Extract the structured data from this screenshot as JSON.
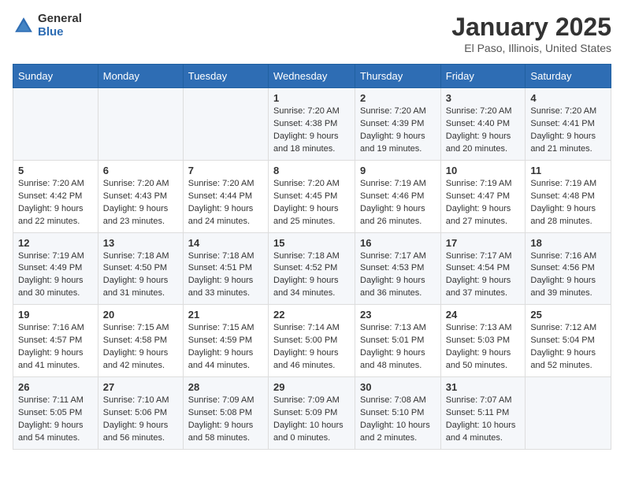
{
  "logo": {
    "general": "General",
    "blue": "Blue"
  },
  "title": "January 2025",
  "subtitle": "El Paso, Illinois, United States",
  "days_of_week": [
    "Sunday",
    "Monday",
    "Tuesday",
    "Wednesday",
    "Thursday",
    "Friday",
    "Saturday"
  ],
  "weeks": [
    [
      {
        "day": "",
        "content": ""
      },
      {
        "day": "",
        "content": ""
      },
      {
        "day": "",
        "content": ""
      },
      {
        "day": "1",
        "content": "Sunrise: 7:20 AM\nSunset: 4:38 PM\nDaylight: 9 hours and 18 minutes."
      },
      {
        "day": "2",
        "content": "Sunrise: 7:20 AM\nSunset: 4:39 PM\nDaylight: 9 hours and 19 minutes."
      },
      {
        "day": "3",
        "content": "Sunrise: 7:20 AM\nSunset: 4:40 PM\nDaylight: 9 hours and 20 minutes."
      },
      {
        "day": "4",
        "content": "Sunrise: 7:20 AM\nSunset: 4:41 PM\nDaylight: 9 hours and 21 minutes."
      }
    ],
    [
      {
        "day": "5",
        "content": "Sunrise: 7:20 AM\nSunset: 4:42 PM\nDaylight: 9 hours and 22 minutes."
      },
      {
        "day": "6",
        "content": "Sunrise: 7:20 AM\nSunset: 4:43 PM\nDaylight: 9 hours and 23 minutes."
      },
      {
        "day": "7",
        "content": "Sunrise: 7:20 AM\nSunset: 4:44 PM\nDaylight: 9 hours and 24 minutes."
      },
      {
        "day": "8",
        "content": "Sunrise: 7:20 AM\nSunset: 4:45 PM\nDaylight: 9 hours and 25 minutes."
      },
      {
        "day": "9",
        "content": "Sunrise: 7:19 AM\nSunset: 4:46 PM\nDaylight: 9 hours and 26 minutes."
      },
      {
        "day": "10",
        "content": "Sunrise: 7:19 AM\nSunset: 4:47 PM\nDaylight: 9 hours and 27 minutes."
      },
      {
        "day": "11",
        "content": "Sunrise: 7:19 AM\nSunset: 4:48 PM\nDaylight: 9 hours and 28 minutes."
      }
    ],
    [
      {
        "day": "12",
        "content": "Sunrise: 7:19 AM\nSunset: 4:49 PM\nDaylight: 9 hours and 30 minutes."
      },
      {
        "day": "13",
        "content": "Sunrise: 7:18 AM\nSunset: 4:50 PM\nDaylight: 9 hours and 31 minutes."
      },
      {
        "day": "14",
        "content": "Sunrise: 7:18 AM\nSunset: 4:51 PM\nDaylight: 9 hours and 33 minutes."
      },
      {
        "day": "15",
        "content": "Sunrise: 7:18 AM\nSunset: 4:52 PM\nDaylight: 9 hours and 34 minutes."
      },
      {
        "day": "16",
        "content": "Sunrise: 7:17 AM\nSunset: 4:53 PM\nDaylight: 9 hours and 36 minutes."
      },
      {
        "day": "17",
        "content": "Sunrise: 7:17 AM\nSunset: 4:54 PM\nDaylight: 9 hours and 37 minutes."
      },
      {
        "day": "18",
        "content": "Sunrise: 7:16 AM\nSunset: 4:56 PM\nDaylight: 9 hours and 39 minutes."
      }
    ],
    [
      {
        "day": "19",
        "content": "Sunrise: 7:16 AM\nSunset: 4:57 PM\nDaylight: 9 hours and 41 minutes."
      },
      {
        "day": "20",
        "content": "Sunrise: 7:15 AM\nSunset: 4:58 PM\nDaylight: 9 hours and 42 minutes."
      },
      {
        "day": "21",
        "content": "Sunrise: 7:15 AM\nSunset: 4:59 PM\nDaylight: 9 hours and 44 minutes."
      },
      {
        "day": "22",
        "content": "Sunrise: 7:14 AM\nSunset: 5:00 PM\nDaylight: 9 hours and 46 minutes."
      },
      {
        "day": "23",
        "content": "Sunrise: 7:13 AM\nSunset: 5:01 PM\nDaylight: 9 hours and 48 minutes."
      },
      {
        "day": "24",
        "content": "Sunrise: 7:13 AM\nSunset: 5:03 PM\nDaylight: 9 hours and 50 minutes."
      },
      {
        "day": "25",
        "content": "Sunrise: 7:12 AM\nSunset: 5:04 PM\nDaylight: 9 hours and 52 minutes."
      }
    ],
    [
      {
        "day": "26",
        "content": "Sunrise: 7:11 AM\nSunset: 5:05 PM\nDaylight: 9 hours and 54 minutes."
      },
      {
        "day": "27",
        "content": "Sunrise: 7:10 AM\nSunset: 5:06 PM\nDaylight: 9 hours and 56 minutes."
      },
      {
        "day": "28",
        "content": "Sunrise: 7:09 AM\nSunset: 5:08 PM\nDaylight: 9 hours and 58 minutes."
      },
      {
        "day": "29",
        "content": "Sunrise: 7:09 AM\nSunset: 5:09 PM\nDaylight: 10 hours and 0 minutes."
      },
      {
        "day": "30",
        "content": "Sunrise: 7:08 AM\nSunset: 5:10 PM\nDaylight: 10 hours and 2 minutes."
      },
      {
        "day": "31",
        "content": "Sunrise: 7:07 AM\nSunset: 5:11 PM\nDaylight: 10 hours and 4 minutes."
      },
      {
        "day": "",
        "content": ""
      }
    ]
  ]
}
